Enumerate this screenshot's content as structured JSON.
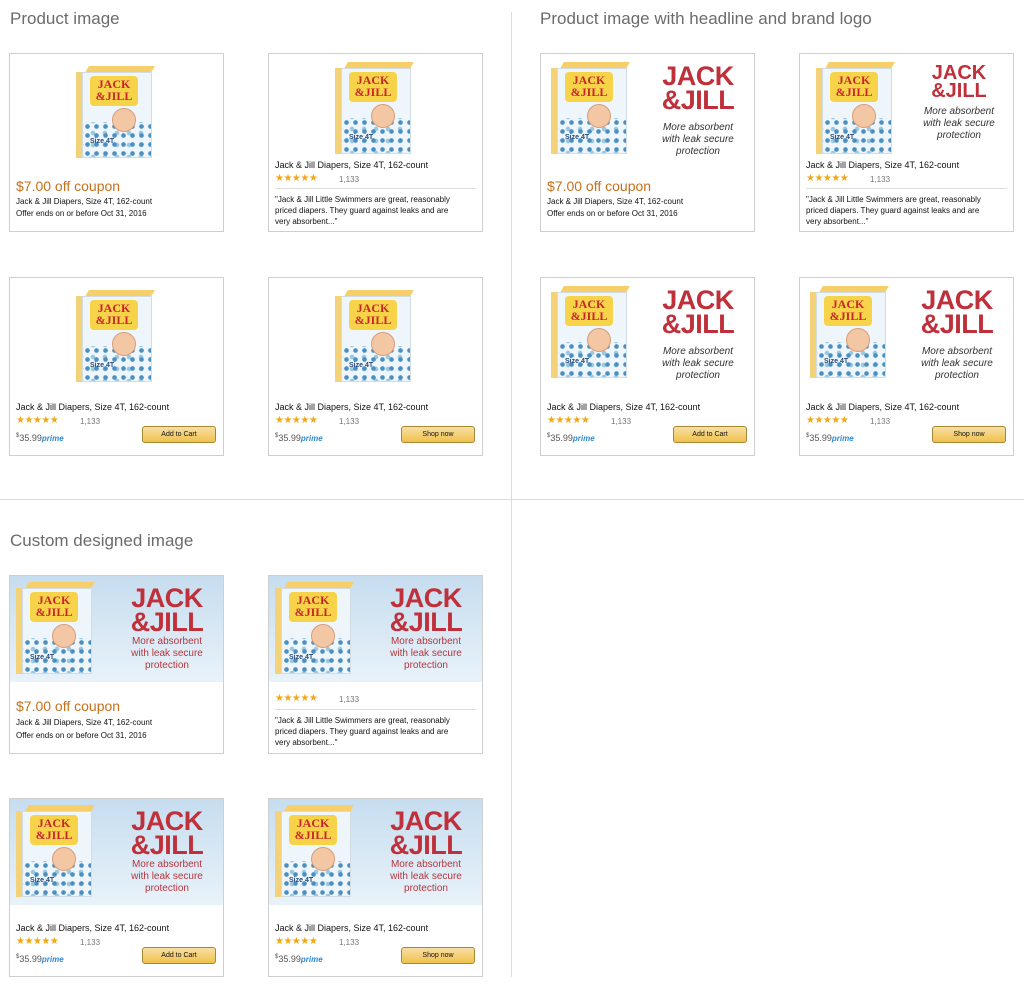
{
  "sections": {
    "product_image": "Product image",
    "headline_logo": "Product image with headline and brand logo",
    "custom_designed": "Custom designed image"
  },
  "product": {
    "title": "Jack & Jill Diapers, Size 4T, 162-count",
    "box_brand_line1": "JACK",
    "box_brand_line2": "&JILL",
    "box_size": "Size 4T",
    "rating_count": "1,133",
    "price_symbol": "$",
    "price_value": "35.99",
    "prime": "prime",
    "stars": "★★★★★",
    "rating_value": 4.5
  },
  "logo": {
    "line1": "JACK",
    "line2": "&JILL"
  },
  "tagline": {
    "line1": "More absorbent",
    "line2": "with leak secure",
    "line3": "protection"
  },
  "coupon": {
    "headline": "$7.00 off coupon",
    "product_line": "Jack & Jill Diapers, Size 4T, 162-count",
    "expiry": "Offer ends on or before Oct 31, 2016"
  },
  "review": {
    "line1": "\"Jack & Jill Little Swimmers are great, reasonably",
    "line2": "priced diapers. They guard against leaks and are",
    "line3": "very absorbent...\""
  },
  "buttons": {
    "add_to_cart": "Add to Cart",
    "shop_now": "Shop now"
  },
  "colors": {
    "coupon": "#c7701b",
    "logo": "#c0303a",
    "star": "#f3a712",
    "button": "#f0c14b",
    "prime": "#2b8ad3"
  }
}
